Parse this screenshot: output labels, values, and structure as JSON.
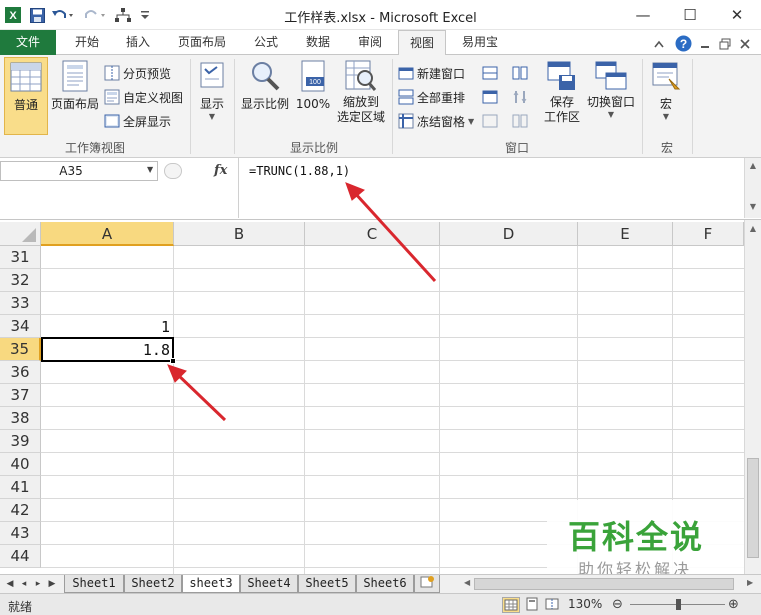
{
  "window": {
    "title": "工作样表.xlsx - Microsoft Excel",
    "minimize": "—",
    "maximize": "☐",
    "close": "✕"
  },
  "tabs": [
    {
      "label": "文件"
    },
    {
      "label": "开始"
    },
    {
      "label": "插入"
    },
    {
      "label": "页面布局"
    },
    {
      "label": "公式"
    },
    {
      "label": "数据"
    },
    {
      "label": "审阅"
    },
    {
      "label": "视图"
    },
    {
      "label": "易用宝"
    }
  ],
  "ribbon": {
    "workbook_views": {
      "group_label": "工作簿视图",
      "normal": "普通",
      "page_layout": "页面布局",
      "page_break_preview": "分页预览",
      "custom_views": "自定义视图",
      "full_screen": "全屏显示"
    },
    "show": {
      "label": "显示"
    },
    "zoom": {
      "group_label": "显示比例",
      "zoom": "显示比例",
      "hundred": "100%",
      "zoom_to_selection_1": "缩放到",
      "zoom_to_selection_2": "选定区域"
    },
    "window": {
      "group_label": "窗口",
      "new_window": "新建窗口",
      "arrange_all": "全部重排",
      "freeze_panes": "冻结窗格",
      "save_workspace_1": "保存",
      "save_workspace_2": "工作区",
      "switch_windows": "切换窗口"
    },
    "macros": {
      "group_label": "宏",
      "macros": "宏"
    }
  },
  "formula_bar": {
    "name_box": "A35",
    "fx": "fx",
    "formula": "=TRUNC(1.88,1)"
  },
  "columns": [
    "A",
    "B",
    "C",
    "D",
    "E",
    "F"
  ],
  "rows": [
    "31",
    "32",
    "33",
    "34",
    "35",
    "36",
    "37",
    "38",
    "39",
    "40",
    "41",
    "42",
    "43",
    "44"
  ],
  "cells": {
    "A34": "1",
    "A35": "1.8"
  },
  "sheets": [
    "Sheet1",
    "Sheet2",
    "sheet3",
    "Sheet4",
    "Sheet5",
    "Sheet6"
  ],
  "active_sheet": "sheet3",
  "status": {
    "ready": "就绪",
    "zoom": "130%"
  },
  "watermark": {
    "main": "百科全说",
    "sub": "助你轻松解决"
  },
  "colors": {
    "file_tab": "#1f7a3d",
    "selected_header": "#f8d980",
    "annotation_arrow": "#d9272e",
    "watermark_green": "#3aa33a"
  }
}
